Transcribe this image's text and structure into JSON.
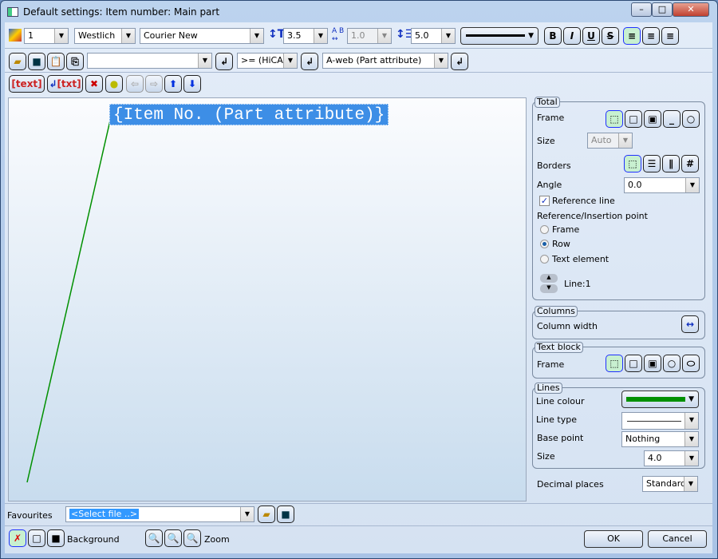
{
  "window": {
    "title": "Default settings: Item number: Main part"
  },
  "toolbar1": {
    "layer": "1",
    "style": "Westlich",
    "font": "Courier New",
    "height": "3.5",
    "width": "1.0",
    "spacing": "5.0",
    "bold": "B",
    "italic": "I",
    "underline": "U",
    "strike": "S"
  },
  "toolbar2": {
    "text_input": "",
    "filter": ">= (HiCAD",
    "attribute": "A-web (Part attribute)"
  },
  "toolbar3": {
    "text_btn": "text",
    "txt_btn": "txt"
  },
  "canvas": {
    "item_text": "{Item No. (Part attribute)}",
    "line_color": "#009000"
  },
  "panel": {
    "total": {
      "title": "Total",
      "frame": "Frame",
      "size": "Size",
      "size_value": "Auto",
      "borders": "Borders",
      "angle": "Angle",
      "angle_value": "0.0",
      "reference_line": "Reference line",
      "ref_point": "Reference/Insertion point",
      "opt_frame": "Frame",
      "opt_row": "Row",
      "opt_text": "Text element",
      "line": "Line:1"
    },
    "columns": {
      "title": "Columns",
      "width": "Column width"
    },
    "textblock": {
      "title": "Text block",
      "frame": "Frame"
    },
    "lines": {
      "title": "Lines",
      "colour": "Line colour",
      "colour_value": "#009000",
      "type": "Line type",
      "base": "Base point",
      "base_value": "Nothing",
      "size": "Size",
      "size_value": "4.0"
    },
    "decimal": "Decimal places",
    "decimal_value": "Standard"
  },
  "footer": {
    "favourites": "Favourites",
    "select_file": "<Select file ..>",
    "background": "Background",
    "zoom": "Zoom",
    "ok": "OK",
    "cancel": "Cancel"
  }
}
